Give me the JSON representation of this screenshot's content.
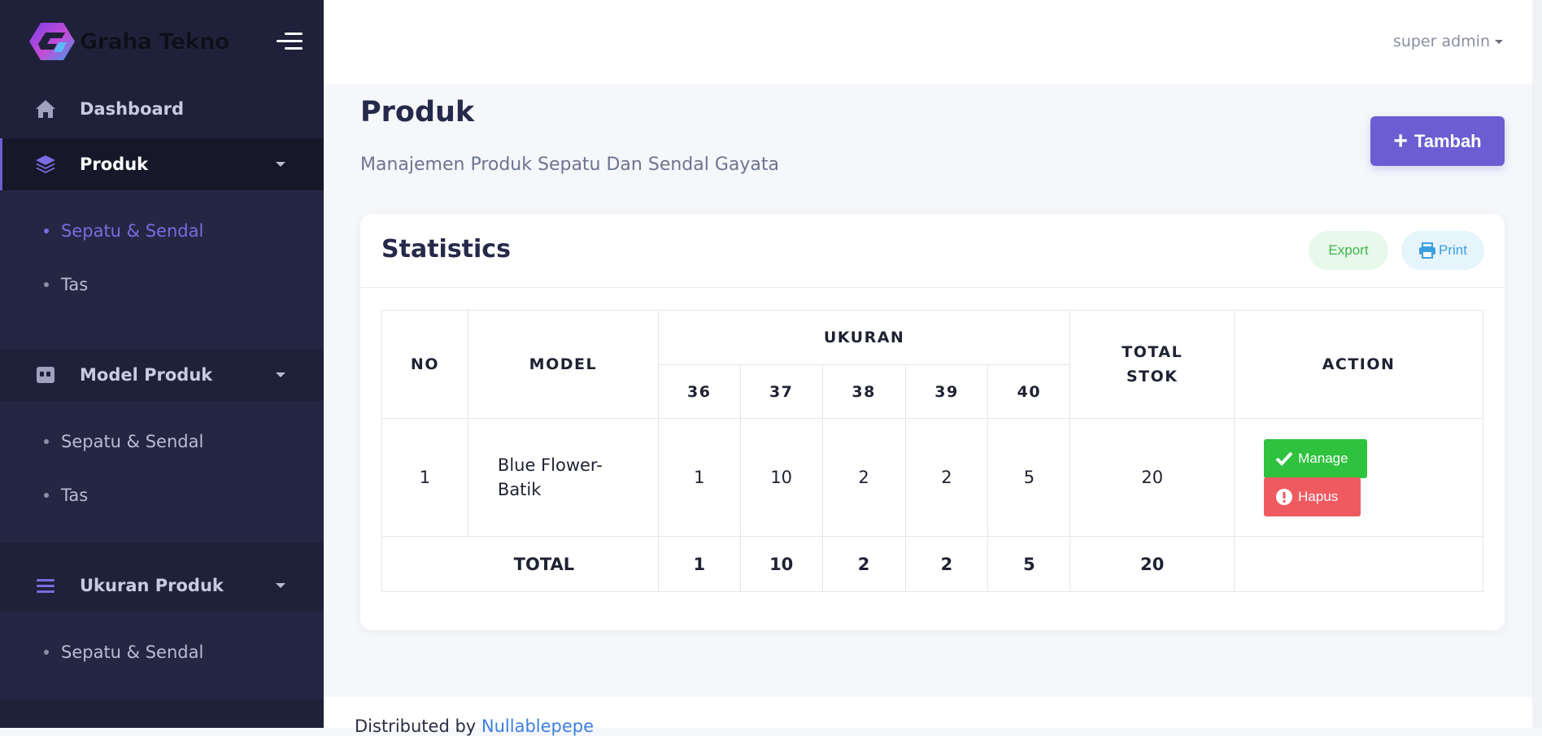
{
  "brand": {
    "name": "Graha Tekno"
  },
  "header": {
    "user": "super admin"
  },
  "sidebar": {
    "items": [
      {
        "label": "Dashboard"
      },
      {
        "label": "Produk",
        "submenu": [
          "Sepatu & Sendal",
          "Tas"
        ]
      },
      {
        "label": "Model Produk",
        "submenu": [
          "Sepatu & Sendal",
          "Tas"
        ]
      },
      {
        "label": "Ukuran Produk",
        "submenu": [
          "Sepatu & Sendal"
        ]
      }
    ]
  },
  "page": {
    "title": "Produk",
    "subtitle": "Manajemen Produk Sepatu Dan Sendal Gayata",
    "add_label": "Tambah"
  },
  "card": {
    "title": "Statistics",
    "export_label": "Export",
    "print_label": "Print"
  },
  "table": {
    "headers": {
      "no": "NO",
      "model": "MODEL",
      "ukuran": "UKURAN",
      "sizes": [
        "36",
        "37",
        "38",
        "39",
        "40"
      ],
      "total_stok_1": "TOTAL",
      "total_stok_2": "STOK",
      "action": "ACTION"
    },
    "rows": [
      {
        "no": "1",
        "model": "Blue Flower-Batik",
        "sizes": [
          "1",
          "10",
          "2",
          "2",
          "5"
        ],
        "total": "20",
        "manage_label": "Manage",
        "delete_label": "Hapus"
      }
    ],
    "total_row": {
      "label": "TOTAL",
      "sizes": [
        "1",
        "10",
        "2",
        "2",
        "5"
      ],
      "total": "20"
    }
  },
  "footer": {
    "text": "Distributed by",
    "link": "Nullablepepe"
  },
  "colors": {
    "sidebar": "#1e2139",
    "accent": "#6c5dd3",
    "success": "#2ec23f",
    "danger": "#ef5a61"
  }
}
